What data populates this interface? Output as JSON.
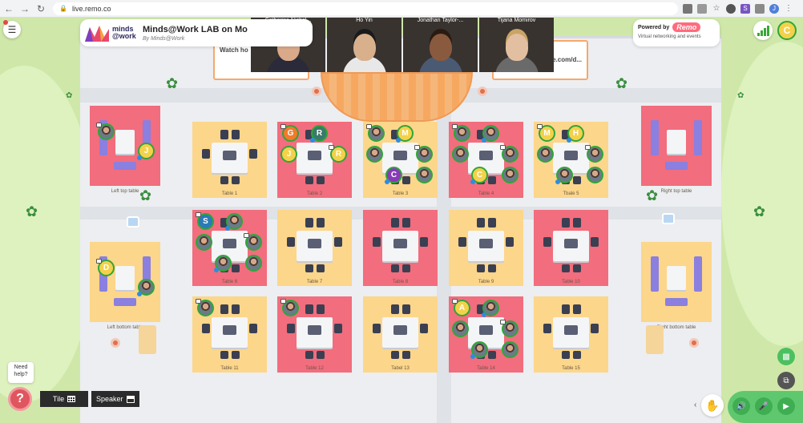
{
  "browser": {
    "url": "live.remo.co",
    "profile_initial": "J",
    "ext_s": "S"
  },
  "header": {
    "logo_line1": "minds",
    "logo_line2": "@work",
    "event_title": "Minds@Work LAB on Mo",
    "event_subtitle": "By Minds@Work"
  },
  "powered": {
    "label": "Powered by",
    "brand": "Remo",
    "tagline": "Virtual networking and events"
  },
  "user": {
    "initial": "C"
  },
  "stage": {
    "left_panel_text": "Watch ho",
    "right_panel_text": "le.com/d..."
  },
  "video_feeds": [
    {
      "name": "Catherine Nichol...",
      "skin": "#d9a98a",
      "hair": "#7a4a2a",
      "shirt": "#2a2a3a"
    },
    {
      "name": "Ho Yin",
      "skin": "#d8b08c",
      "hair": "#1a1a1a",
      "shirt": "#e8e8e8"
    },
    {
      "name": "Jonathan Taylor-...",
      "skin": "#8a5a3e",
      "hair": "#2a1a12",
      "shirt": "#4a5a72"
    },
    {
      "name": "Tijana Momirov",
      "skin": "#e2bfa0",
      "hair": "#c9a466",
      "shirt": "#6a6a6a"
    }
  ],
  "tables": [
    {
      "label": "Left top table",
      "theme": "lounge-pink",
      "avatars": [
        {
          "kind": "photo"
        },
        {
          "kind": "letter",
          "letter": "J",
          "color": "#f4d14a"
        }
      ]
    },
    {
      "label": "Table 1",
      "theme": "yellow",
      "avatars": []
    },
    {
      "label": "Table 2",
      "theme": "pink",
      "avatars": [
        {
          "kind": "letter",
          "letter": "G",
          "color": "#f37a2a"
        },
        {
          "kind": "letter",
          "letter": "R",
          "color": "#3a7a6a"
        },
        {
          "kind": "letter",
          "letter": "J",
          "color": "#f4d14a"
        },
        {
          "kind": "letter",
          "letter": "R",
          "color": "#f4d14a"
        }
      ]
    },
    {
      "label": "Table 3",
      "theme": "yellow",
      "avatars": [
        {
          "kind": "photo"
        },
        {
          "kind": "letter",
          "letter": "M",
          "color": "#f4d14a"
        },
        {
          "kind": "photo"
        },
        {
          "kind": "photo"
        },
        {
          "kind": "letter",
          "letter": "C",
          "color": "#8a3ab8"
        },
        {
          "kind": "photo"
        }
      ]
    },
    {
      "label": "Table 4",
      "theme": "pink",
      "avatars": [
        {
          "kind": "photo"
        },
        {
          "kind": "photo"
        },
        {
          "kind": "photo"
        },
        {
          "kind": "photo"
        },
        {
          "kind": "letter",
          "letter": "C",
          "color": "#f4d14a"
        },
        {
          "kind": "photo"
        }
      ]
    },
    {
      "label": "Tbale 5",
      "theme": "yellow",
      "avatars": [
        {
          "kind": "letter",
          "letter": "M",
          "color": "#f4d14a"
        },
        {
          "kind": "letter",
          "letter": "H",
          "color": "#f4d14a"
        },
        {
          "kind": "photo"
        },
        {
          "kind": "photo"
        },
        {
          "kind": "photo"
        },
        {
          "kind": "photo"
        }
      ]
    },
    {
      "label": "Right top table",
      "theme": "lounge-pink",
      "avatars": []
    },
    {
      "label": "Left bottom table",
      "theme": "lounge-yellow",
      "avatars": [
        {
          "kind": "letter",
          "letter": "D",
          "color": "#f4d14a"
        },
        {
          "kind": "photo"
        }
      ]
    },
    {
      "label": "Table 6",
      "theme": "pink",
      "avatars": [
        {
          "kind": "letter",
          "letter": "S",
          "color": "#2a7ab8"
        },
        {
          "kind": "photo"
        },
        {
          "kind": "photo"
        },
        {
          "kind": "photo"
        },
        {
          "kind": "photo"
        },
        {
          "kind": "photo"
        }
      ]
    },
    {
      "label": "Table 7",
      "theme": "yellow",
      "avatars": []
    },
    {
      "label": "Table 8",
      "theme": "pink",
      "avatars": []
    },
    {
      "label": "Table 9",
      "theme": "yellow",
      "avatars": []
    },
    {
      "label": "Table 10",
      "theme": "pink",
      "avatars": []
    },
    {
      "label": "Right bottom table",
      "theme": "lounge-yellow",
      "avatars": []
    },
    {
      "label": "Table 11",
      "theme": "yellow",
      "avatars": [
        {
          "kind": "photo"
        }
      ]
    },
    {
      "label": "Table 12",
      "theme": "pink",
      "avatars": [
        {
          "kind": "photo"
        }
      ]
    },
    {
      "label": "Tabel 13",
      "theme": "yellow",
      "avatars": []
    },
    {
      "label": "Table 14",
      "theme": "pink",
      "avatars": [
        {
          "kind": "letter",
          "letter": "A",
          "color": "#f4d14a"
        },
        {
          "kind": "photo"
        },
        {
          "kind": "photo"
        },
        {
          "kind": "photo"
        },
        {
          "kind": "photo"
        },
        {
          "kind": "photo"
        }
      ]
    },
    {
      "label": "Table 15",
      "theme": "yellow",
      "avatars": []
    }
  ],
  "bottom": {
    "need_help": "Need help?",
    "help_icon": "?",
    "tile_label": "Tile",
    "speaker_label": "Speaker"
  },
  "colors": {
    "grass": "#cfe8a9",
    "floor": "#eceef1",
    "pink_table": "#f26d7d",
    "yellow_table": "#fcd68a",
    "online_ring": "#2ea63a",
    "control_green": "#4cc060"
  }
}
